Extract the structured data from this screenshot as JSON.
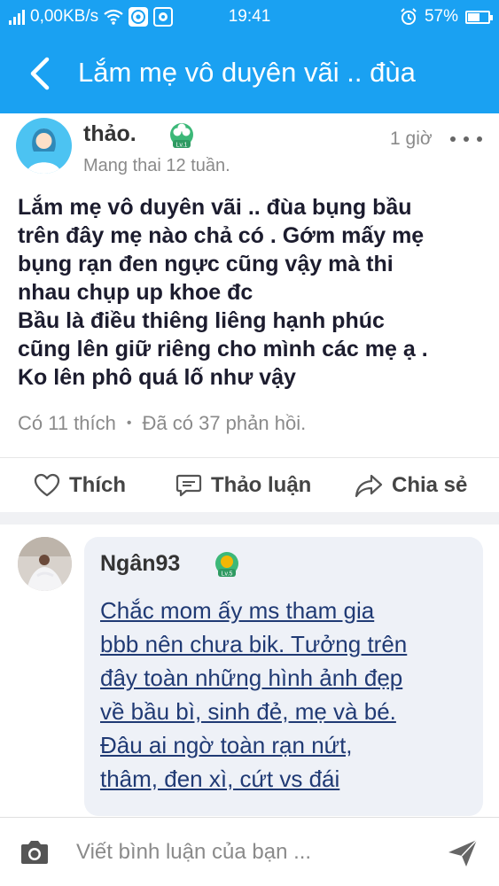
{
  "status_bar": {
    "network_speed": "0,00KB/s",
    "time": "19:41",
    "battery_percent": "57%",
    "battery_level": 0.57,
    "icons": [
      "signal-icon",
      "wifi-icon",
      "chrome-icon",
      "camera-app-icon",
      "alarm-icon",
      "battery-icon"
    ]
  },
  "app_bar": {
    "title": "Lắm mẹ vô duyên vãi .. đùa",
    "back_icon": "chevron-left-icon"
  },
  "post": {
    "author": "thảo.",
    "author_level": "Lv.1",
    "subtitle": "Mang thai 12 tuần.",
    "time": "1 giờ",
    "body_lines": [
      "Lắm mẹ vô duyên vãi .. đùa bụng bầu",
      "trên đây mẹ nào chả có . Gớm mấy mẹ",
      "bụng rạn đen ngực cũng vậy mà thi",
      "nhau chụp up khoe đc",
      "Bầu là điều thiêng liêng hạnh phúc",
      "cũng lên giữ riêng cho mình các mẹ ạ .",
      "Ko lên phô quá lố như vậy"
    ],
    "likes_text": "Có 11 thích",
    "replies_text": "Đã có 37 phản hồi."
  },
  "actions": {
    "like": "Thích",
    "discuss": "Thảo luận",
    "share": "Chia sẻ"
  },
  "comment": {
    "author": "Ngân93",
    "author_level": "Lv.5",
    "lines": [
      "Chắc mom ấy ms tham gia",
      "bbb nên chưa bik. Tưởng trên",
      "đây toàn những hình ảnh đẹp",
      "về bầu bì, sinh đẻ, mẹ và bé.",
      "Đâu ai ngờ toàn rạn nứt,",
      "thâm, đen xì, cứt vs đái"
    ]
  },
  "composer": {
    "placeholder": "Viết bình luận của bạn ...",
    "value": ""
  },
  "colors": {
    "brand": "#1aa1f2",
    "badge_green": "#3cb878",
    "badge_gold": "#f2b705",
    "comment_text": "#203a74"
  }
}
